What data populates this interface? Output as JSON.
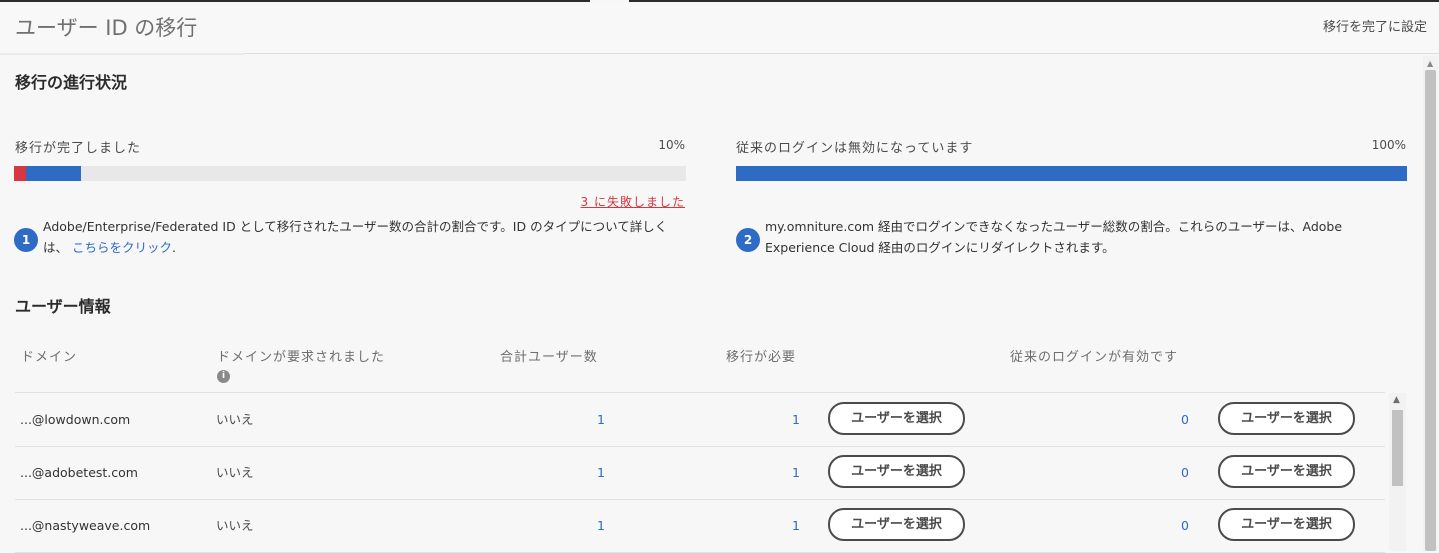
{
  "header": {
    "title": "ユーザー ID の移行",
    "complete_link": "移行を完了に設定"
  },
  "progress": {
    "heading": "移行の進行状況",
    "migration": {
      "label": "移行が完了しました",
      "percent_text": "10%",
      "completed_fraction": 0.1,
      "failed_link": "3 に失敗しました",
      "note_number": "1",
      "note_text": "Adobe/Enterprise/Federated ID として移行されたユーザー数の合計の割合です。ID のタイプについて詳しくは、",
      "note_link": "こちらをクリック",
      "note_end": "."
    },
    "legacy": {
      "label": "従来のログインは無効になっています",
      "percent_text": "100%",
      "completed_fraction": 1.0,
      "note_number": "2",
      "note_text": "my.omniture.com 経由でログインできなくなったユーザー総数の割合。これらのユーザーは、Adobe Experience Cloud 経由のログインにリダイレクトされます。"
    }
  },
  "users": {
    "heading": "ユーザー情報",
    "columns": {
      "domain": "ドメイン",
      "claimed": "ドメインが要求されました",
      "total": "合計ユーザー数",
      "migration_needed": "移行が必要",
      "legacy_enabled": "従来のログインが有効です"
    },
    "select_button": "ユーザーを選択",
    "rows": [
      {
        "domain": "...@lowdown.com",
        "claimed": "いいえ",
        "total": "1",
        "migration": "1",
        "legacy": "0"
      },
      {
        "domain": "...@adobetest.com",
        "claimed": "いいえ",
        "total": "1",
        "migration": "1",
        "legacy": "0"
      },
      {
        "domain": "...@nastyweave.com",
        "claimed": "いいえ",
        "total": "1",
        "migration": "1",
        "legacy": "0"
      }
    ]
  },
  "colors": {
    "accent_blue": "#2d6bc4",
    "error_red": "#d7373f",
    "bar_track": "#e8e8e8"
  }
}
